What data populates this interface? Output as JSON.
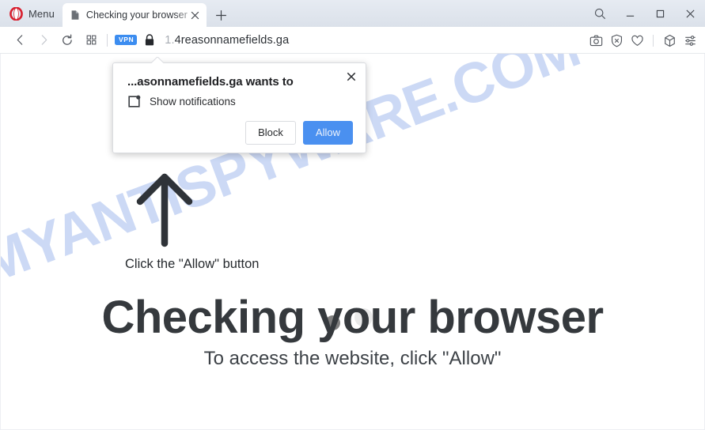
{
  "browser": {
    "menu_label": "Menu",
    "logo_name": "opera-logo",
    "tab": {
      "title": "Checking your browser",
      "favicon_name": "page-favicon",
      "close_name": "tab-close-icon"
    },
    "new_tab_label": "+",
    "window_controls": {
      "search_label": "search-icon",
      "minimize_label": "minimize-icon",
      "maximize_label": "maximize-icon",
      "close_label": "close-icon"
    },
    "address_bar": {
      "back_label": "back-icon",
      "forward_label": "forward-icon",
      "reload_label": "reload-icon",
      "speeddial_label": "speed-dial-icon",
      "vpn_badge": "VPN",
      "lock_label": "lock-icon",
      "url_scheme": "1.",
      "url_host": "4reasonnamefields.ga",
      "right_icons": [
        {
          "name": "snapshot-camera-icon"
        },
        {
          "name": "ad-blocker-shield-icon"
        },
        {
          "name": "heart-favorites-icon"
        },
        {
          "name": "extensions-cube-icon"
        },
        {
          "name": "easy-setup-sliders-icon"
        }
      ]
    }
  },
  "permission_popup": {
    "title": "...asonnamefields.ga wants to",
    "permission_icon_name": "notifications-icon",
    "permission_text": "Show notifications",
    "block_label": "Block",
    "allow_label": "Allow",
    "close_label": "close-icon"
  },
  "page": {
    "watermark": "MYANTISPYWARE.COM",
    "watermark_color": "#ccd9f5",
    "arrow_name": "up-arrow-icon",
    "click_hint": "Click the \"Allow\" button",
    "headline": "Checking your browser",
    "subline": "To access the website, click \"Allow\"",
    "loader_dot_dark_color": "#7e7e7e",
    "loader_dot_light_color": "#e9e9e9"
  },
  "colors": {
    "accent_blue": "#4a90f0",
    "opera_red": "#d8202f",
    "vpn_blue": "#3c8df0",
    "headline_gray": "#35393d"
  }
}
